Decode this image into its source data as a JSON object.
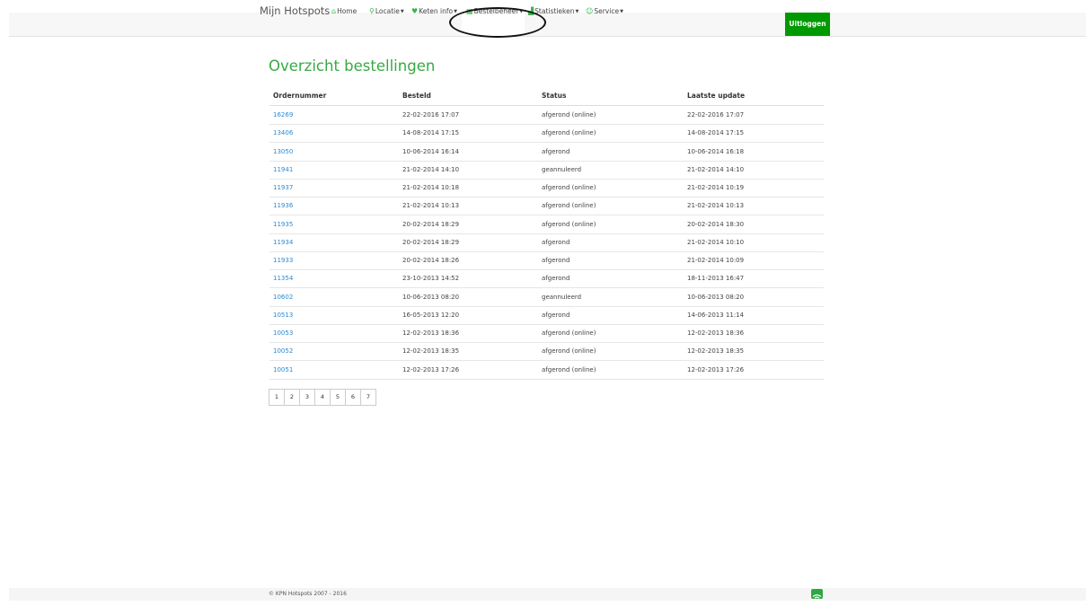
{
  "nav": {
    "brand": "Mijn Hotspots",
    "items": [
      {
        "label": "Home"
      },
      {
        "label": "Locatie"
      },
      {
        "label": "Keten info"
      },
      {
        "label": "Bestelbeheer"
      },
      {
        "label": "Statistieken"
      },
      {
        "label": "Service"
      }
    ],
    "logout": "Uitloggen"
  },
  "page": {
    "title": "Overzicht bestellingen"
  },
  "table": {
    "headers": [
      "Ordernummer",
      "Besteld",
      "Status",
      "Laatste update"
    ],
    "rows": [
      [
        "16269",
        "22-02-2016 17:07",
        "afgerond (online)",
        "22-02-2016 17:07"
      ],
      [
        "13406",
        "14-08-2014 17:15",
        "afgerond (online)",
        "14-08-2014 17:15"
      ],
      [
        "13050",
        "10-06-2014 16:14",
        "afgerond",
        "10-06-2014 16:18"
      ],
      [
        "11941",
        "21-02-2014 14:10",
        "geannuleerd",
        "21-02-2014 14:10"
      ],
      [
        "11937",
        "21-02-2014 10:18",
        "afgerond (online)",
        "21-02-2014 10:19"
      ],
      [
        "11936",
        "21-02-2014 10:13",
        "afgerond (online)",
        "21-02-2014 10:13"
      ],
      [
        "11935",
        "20-02-2014 18:29",
        "afgerond (online)",
        "20-02-2014 18:30"
      ],
      [
        "11934",
        "20-02-2014 18:29",
        "afgerond",
        "21-02-2014 10:10"
      ],
      [
        "11933",
        "20-02-2014 18:26",
        "afgerond",
        "21-02-2014 10:09"
      ],
      [
        "11354",
        "23-10-2013 14:52",
        "afgerond",
        "18-11-2013 16:47"
      ],
      [
        "10602",
        "10-06-2013 08:20",
        "geannuleerd",
        "10-06-2013 08:20"
      ],
      [
        "10513",
        "16-05-2013 12:20",
        "afgerond",
        "14-06-2013 11:14"
      ],
      [
        "10053",
        "12-02-2013 18:36",
        "afgerond (online)",
        "12-02-2013 18:36"
      ],
      [
        "10052",
        "12-02-2013 18:35",
        "afgerond (online)",
        "12-02-2013 18:35"
      ],
      [
        "10051",
        "12-02-2013 17:26",
        "afgerond (online)",
        "12-02-2013 17:26"
      ]
    ]
  },
  "pagination": [
    "1",
    "2",
    "3",
    "4",
    "5",
    "6",
    "7"
  ],
  "footer": {
    "copyright": "© KPN Hotspots 2007 - 2016"
  },
  "colors": {
    "accent": "#39a845",
    "logout_bg": "#009a00",
    "link": "#2a8ad4"
  }
}
